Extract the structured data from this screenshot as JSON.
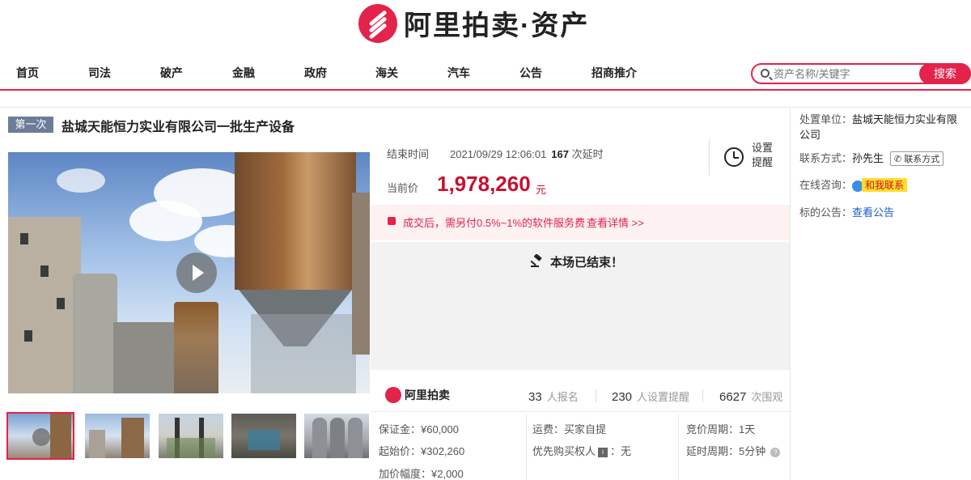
{
  "header": {
    "logo_text": "阿里拍卖·资产"
  },
  "nav": {
    "items": [
      "首页",
      "司法",
      "破产",
      "金融",
      "政府",
      "海关",
      "汽车",
      "公告",
      "招商推介"
    ]
  },
  "search": {
    "placeholder": "资产名称/关键字",
    "button_label": "搜索"
  },
  "auction": {
    "round_tag": "第一次",
    "title": "盐城天能恒力实业有限公司一批生产设备",
    "end_label": "结束时间",
    "end_time": "2021/09/29 12:06:01",
    "extensions_count": "167",
    "extensions_label": "次延时",
    "reminder_label": "设置提醒",
    "current_price_label": "当前价",
    "current_price": "1,978,260",
    "currency_unit": "元",
    "fee_notice": "成交后，需另付0.5%~1%的软件服务费",
    "fee_link": "查看详情 >>",
    "status": "本场已结束！"
  },
  "stats": {
    "brand": "阿里拍卖",
    "signups": "33",
    "signups_label": "人报名",
    "reminders": "230",
    "reminders_label": "人设置提醒",
    "viewers": "6627",
    "viewers_label": "次围观"
  },
  "details": {
    "deposit": "保证金：¥60,000",
    "start_price": "起始价：¥302,260",
    "increment": "加价幅度：¥2,000",
    "freight": "运费：买家自提",
    "priority_label": "优先购买权人",
    "priority_value": "：无",
    "bid_cycle": "竞价周期：1天",
    "extension_cycle": "延时周期：5分钟"
  },
  "sidebar": {
    "unit_label": "处置单位：",
    "unit_value": "盐城天能恒力实业有限公司",
    "contact_label": "联系方式：",
    "contact_value": "孙先生",
    "contact_button": "联系方式",
    "consult_label": "在线咨询：",
    "consult_button": "和我联系",
    "notice_label": "标的公告：",
    "notice_link": "查看公告"
  },
  "colors": {
    "accent": "#e4234b",
    "price": "#c8102e",
    "link": "#1a5ec7",
    "tag_bg": "#6b7d99"
  }
}
